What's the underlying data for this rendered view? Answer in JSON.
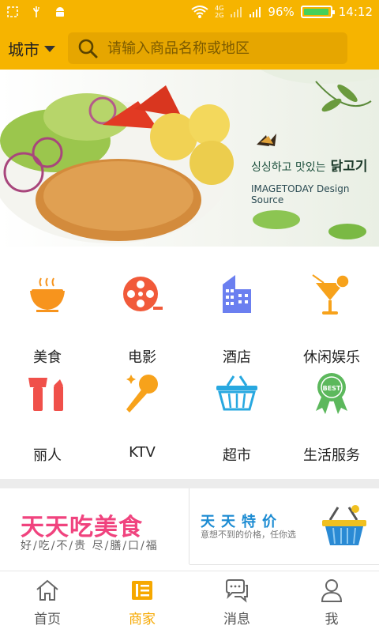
{
  "status_bar": {
    "battery_percent": "96%",
    "battery_level": 0.96,
    "network_top": "4G",
    "network_bottom": "2G",
    "time": "14:12",
    "icons": [
      "screenshot-icon",
      "usb-icon",
      "android-icon",
      "wifi-icon",
      "signal-icon",
      "battery-icon"
    ]
  },
  "header": {
    "city_label": "城市",
    "search_placeholder": "请输入商品名称或地区"
  },
  "banner": {
    "korean_text": "싱싱하고 맛있는",
    "korean_word": "닭고기",
    "brand_text": "IMAGETODAY Design Source"
  },
  "categories": [
    {
      "label": "美食",
      "icon": "food-bowl-icon",
      "color": "#f7941d"
    },
    {
      "label": "电影",
      "icon": "film-reel-icon",
      "color": "#f15a3a"
    },
    {
      "label": "酒店",
      "icon": "hotel-building-icon",
      "color": "#6b7ff0"
    },
    {
      "label": "休闲娱乐",
      "icon": "cocktail-icon",
      "color": "#f7a21b"
    },
    {
      "label": "丽人",
      "icon": "beauty-icon",
      "color": "#f0504a"
    },
    {
      "label": "KTV",
      "icon": "microphone-icon",
      "color": "#f7a21b"
    },
    {
      "label": "超市",
      "icon": "shopping-basket-icon",
      "color": "#28a8e0"
    },
    {
      "label": "生活服务",
      "icon": "badge-best-icon",
      "color": "#5cb85c"
    }
  ],
  "promos": {
    "left": {
      "title": "天天吃美食",
      "subtitle": "好/吃/不/贵 尽/膳/口/福"
    },
    "right": {
      "title": "天天特价",
      "subtitle": "意想不到的价格，任你选"
    }
  },
  "tabs": [
    {
      "label": "首页",
      "icon": "home-icon",
      "active": false
    },
    {
      "label": "商家",
      "icon": "merchant-list-icon",
      "active": true
    },
    {
      "label": "消息",
      "icon": "chat-bubble-icon",
      "active": false
    },
    {
      "label": "我",
      "icon": "user-icon",
      "active": false
    }
  ],
  "colors": {
    "brand": "#f6b400",
    "active_tab": "#f6a800",
    "promo_pink": "#f0437e",
    "promo_blue": "#1b8bd2"
  }
}
